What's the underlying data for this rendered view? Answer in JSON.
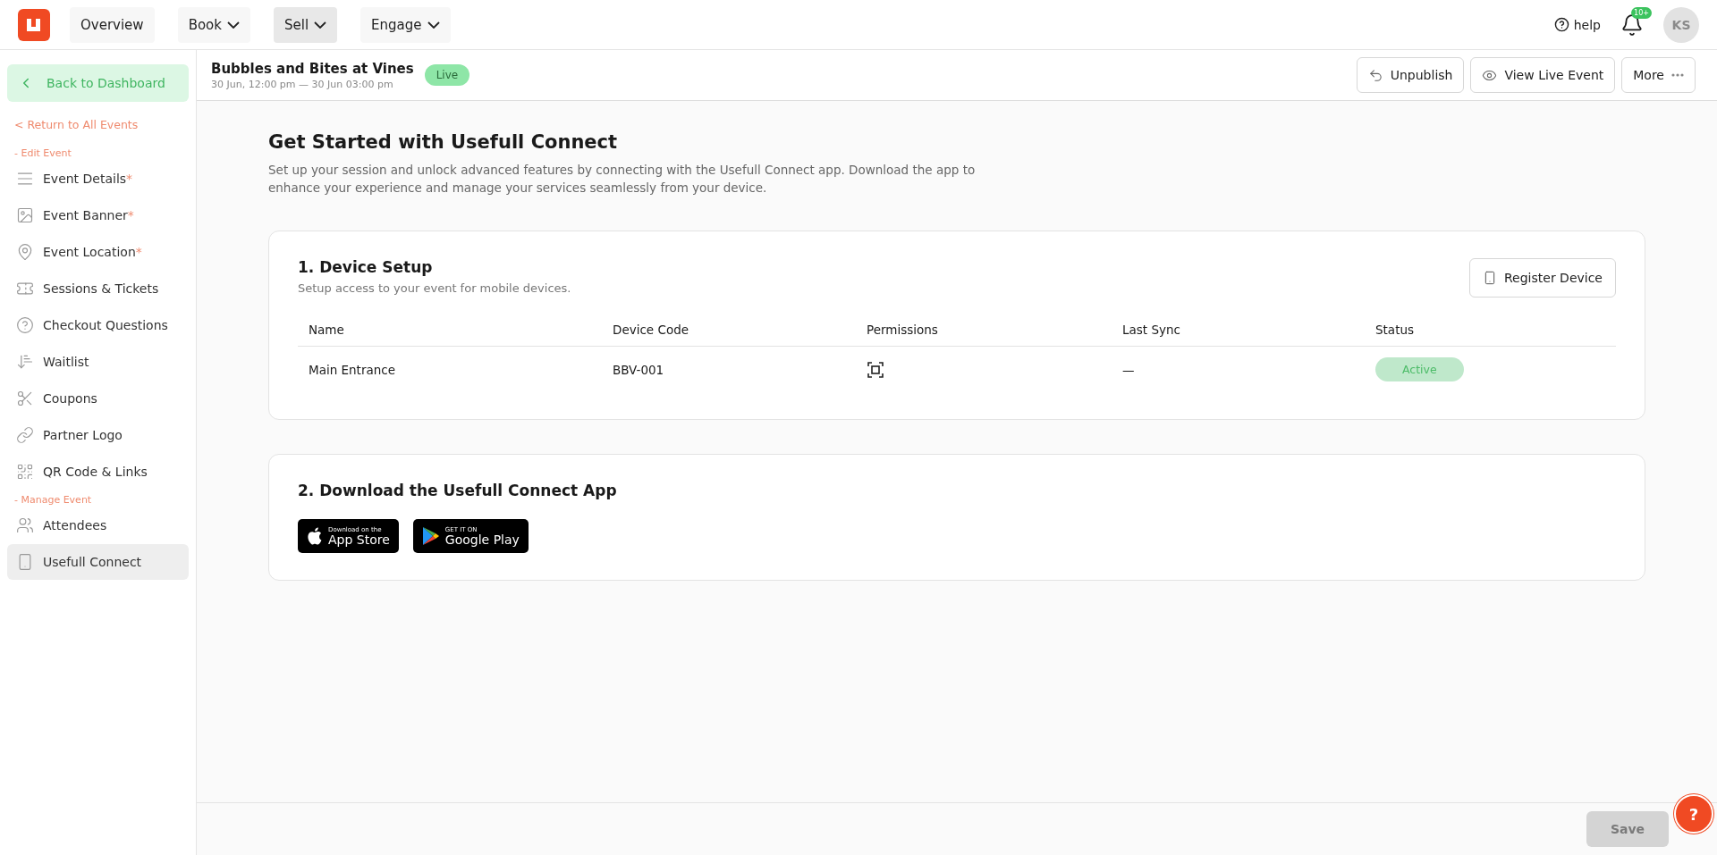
{
  "top_nav": {
    "items": [
      {
        "label": "Overview",
        "dropdown": false,
        "selected": false
      },
      {
        "label": "Book",
        "dropdown": true,
        "selected": false
      },
      {
        "label": "Sell",
        "dropdown": true,
        "selected": true
      },
      {
        "label": "Engage",
        "dropdown": true,
        "selected": false
      }
    ],
    "help": "help",
    "notification_badge": "10+",
    "avatar": "KS"
  },
  "sidebar": {
    "back": "Back to Dashboard",
    "return_link": "< Return to All Events",
    "sections": [
      {
        "title": "- Edit Event",
        "items": [
          {
            "label": "Event Details",
            "required_mark": "*",
            "selected": false
          },
          {
            "label": "Event Banner",
            "required_mark": "*",
            "selected": false
          },
          {
            "label": "Event Location",
            "required_mark": "*",
            "selected": false
          },
          {
            "label": "Sessions & Tickets",
            "selected": false
          },
          {
            "label": "Checkout Questions",
            "selected": false
          },
          {
            "label": "Waitlist",
            "selected": false
          },
          {
            "label": "Coupons",
            "selected": false
          },
          {
            "label": "Partner Logo",
            "selected": false
          },
          {
            "label": "QR Code & Links",
            "selected": false
          }
        ]
      },
      {
        "title": "- Manage Event",
        "items": [
          {
            "label": "Attendees",
            "selected": false
          },
          {
            "label": "Usefull Connect",
            "selected": true
          }
        ]
      }
    ]
  },
  "event_header": {
    "title": "Bubbles and Bites at Vines",
    "dates": "30 Jun, 12:00 pm — 30 Jun 03:00 pm",
    "status": "Live",
    "actions": [
      {
        "label": "Unpublish"
      },
      {
        "label": "View Live Event"
      },
      {
        "label": "More"
      }
    ]
  },
  "page": {
    "title": "Get Started with Usefull Connect",
    "intro": "Set up your session and unlock advanced features by connecting with the Usefull Connect app. Download the app to enhance your experience and manage your services seamlessly from your device.",
    "device_setup": {
      "title": "1. Device Setup",
      "subtitle": "Setup access to your event for mobile devices.",
      "button": "Register Device",
      "columns": [
        "Name",
        "Device Code",
        "Permissions",
        "Last Sync",
        "Status"
      ],
      "rows": [
        {
          "name": "Main Entrance",
          "code": "BBV-001",
          "last_sync": "—",
          "status": "Active"
        }
      ]
    },
    "download": {
      "title": "2. Download the Usefull Connect App",
      "stores": [
        {
          "kind": "apple",
          "small": "Download on the",
          "big": "App Store"
        },
        {
          "kind": "google",
          "small": "GET IT ON",
          "big": "Google Play"
        }
      ]
    }
  },
  "footer": {
    "save": "Save",
    "save_disabled": true,
    "help_fab": "?"
  }
}
